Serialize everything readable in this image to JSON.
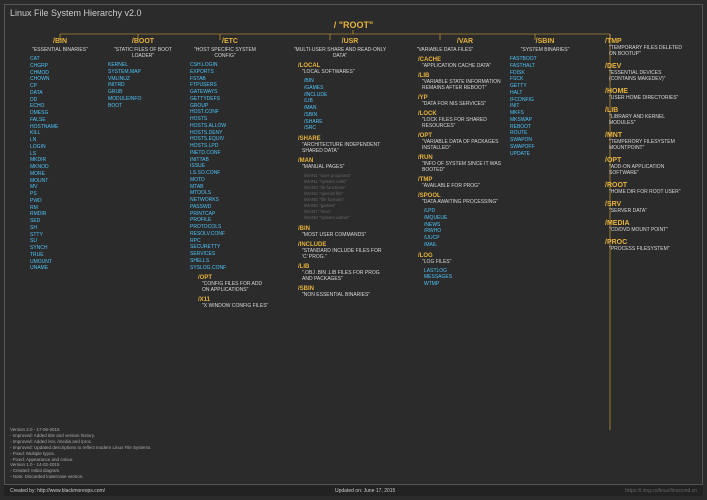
{
  "title": "Linux File System Hierarchy v2.0",
  "root": "/ \"ROOT\"",
  "columns": {
    "bin": {
      "name": "/BIN",
      "desc": "\"ESSENTIAL BINARIES\"",
      "items": [
        "CAT",
        "CHGRP",
        "CHMOD",
        "CHOWN",
        "CP",
        "DATA",
        "DD",
        "ECHO",
        "DMESG",
        "FALSE",
        "HOSTNAME",
        "KILL",
        "LN",
        "LOGIN",
        "LS",
        "MKDIR",
        "MKNOD",
        "MORE",
        "MOUNT",
        "MV",
        "PS",
        "PWD",
        "RM",
        "RMDIR",
        "SED",
        "SH",
        "STTY",
        "SU",
        "SYNCH",
        "TRUE",
        "UMOUNT",
        "UNAME"
      ]
    },
    "boot": {
      "name": "/BOOT",
      "desc": "\"STATIC FILES OF BOOT LOADER\"",
      "items": [
        "KERNEL",
        "SYSTEM.MAP",
        "VMLINUZ",
        "INITRD",
        "GRUB",
        "MODULEINFO",
        "BOOT"
      ]
    },
    "etc": {
      "name": "/ETC",
      "desc": "\"HOST SPECIFIC SYSTEM CONFIG\"",
      "items": [
        "CSH.LOGIN",
        "EXPORTS",
        "FSTAB",
        "FTPUSERS",
        "GATEWAYS",
        "GETTYDEFS",
        "GROUP",
        "HOST.CONF",
        "HOSTS",
        "HOSTS.ALLOW",
        "HOSTS.DENY",
        "HOSTS.EQUIV",
        "HOSTS.LPD",
        "INETD.CONF",
        "INITTAB",
        "ISSUE",
        "LS.SO.CONF",
        "MOTD",
        "MTAB",
        "MTOOLS",
        "NETWORKS",
        "PASSWD",
        "PRINTCAP",
        "PROFILE",
        "PROTOCOLS",
        "RESOLV.CONF",
        "RPC",
        "SECURETTY",
        "SERVICES",
        "SHELLS",
        "SYSLOG.CONF"
      ],
      "subs": [
        {
          "name": "/OPT",
          "desc": "\"CONFIG FILES FOR ADD ON APPLICATIONS\""
        },
        {
          "name": "/X11",
          "desc": "\"X WINDOW CONFIG FILES\""
        }
      ]
    },
    "usr": {
      "name": "/USR",
      "desc": "\"MULTI-USER SHARE AND READ-ONLY DATA\"",
      "subs": [
        {
          "name": "/LOCAL",
          "desc": "\"LOCAL SOFTWARES\"",
          "items": [
            "/BIN",
            "/GAMES",
            "/INCLUDE",
            "/LIB",
            "/MAN",
            "/SBIN",
            "/SHARE",
            "/SRC"
          ]
        },
        {
          "name": "/SHARE",
          "desc": "\"ARCHITECTURE INDEPENDENT SHARED DATA\""
        },
        {
          "name": "/MAN",
          "desc": "\"MANUAL PAGES\"",
          "man": [
            "/MAN1 \"user programs\"",
            "/MAN2 \"system calls\"",
            "/MAN3 \"lib functions\"",
            "/MAN4 \"special file\"",
            "/MAN5 \"file formats\"",
            "/MAN6 \"games\"",
            "/MAN7 \"misc\"",
            "/MAN8 \"system admin\""
          ]
        },
        {
          "name": "/BIN",
          "desc": "\"MOST USER COMMANDS\""
        },
        {
          "name": "/INCLUDE",
          "desc": "\"STANDARD INCLUDE FILES FOR 'C' PROG.\""
        },
        {
          "name": "/LIB",
          "desc": "\".OBJ .BIN .LIB FILES FOR PROG AND PACKAGES\""
        },
        {
          "name": "/SBIN",
          "desc": "\"NON ESSENTIAL BINARIES\""
        }
      ]
    },
    "var": {
      "name": "/VAR",
      "desc": "\"VARIABLE DATA FILES\"",
      "subs": [
        {
          "name": "/CACHE",
          "desc": "\"APPLICATION CACHE DATA\""
        },
        {
          "name": "/LIB",
          "desc": "\"VARIABLE STATE INFORMATION REMAINS AFTER REBOOT\""
        },
        {
          "name": "/YP",
          "desc": "\"DATA FOR NIS SERVICES\""
        },
        {
          "name": "/LOCK",
          "desc": "\"LOCK FILES FOR SHARED RESOURCES\""
        },
        {
          "name": "/OPT",
          "desc": "\"VARIABLE DATA OF PACKAGES INSTALLED\""
        },
        {
          "name": "/RUN",
          "desc": "\"INFO OF SYSTEM SINCE IT WAS BOOTED\""
        },
        {
          "name": "/TMP",
          "desc": "\"AVAILABLE FOR PROG\""
        },
        {
          "name": "/SPOOL",
          "desc": "\"DATA AWAITING PROCESSING\"",
          "items": [
            "/LPD",
            "/MQUEUE",
            "/NEWS",
            "/RWHO",
            "/UUCP",
            "/MAIL"
          ]
        },
        {
          "name": "/LOG",
          "desc": "\"LOG FILES\"",
          "items": [
            "LASTLOG",
            "MESSAGES",
            "WTMP"
          ]
        }
      ]
    },
    "sbin": {
      "name": "/SBIN",
      "desc": "\"SYSTEM BINARIES\"",
      "items": [
        "FASTBOOT",
        "FASTHALT",
        "FDISK",
        "FSCK",
        "GETTY",
        "HALT",
        "IFCONFIG",
        "INIT",
        "MKFS",
        "MKSWAP",
        "REBOOT",
        "ROUTE",
        "SWAPON",
        "SWAPOFF",
        "UPDATE"
      ]
    }
  },
  "right": [
    {
      "name": "/TMP",
      "desc": "\"TEMPORARY FILES DELETED ON BOOTUP\""
    },
    {
      "name": "/DEV",
      "desc": "\"ESSENTIAL DEVICES (CONTAINS MAKEDEV)\""
    },
    {
      "name": "/HOME",
      "desc": "\"USER HOME DIRECTORIES\""
    },
    {
      "name": "/LIB",
      "desc": "\"LIBRARY AND KERNEL MODULES\""
    },
    {
      "name": "/MNT",
      "desc": "\"TEMPERORY FILESYSTEM MOUNTPOINT\""
    },
    {
      "name": "/OPT",
      "desc": "\"ADD-ON APPLICATION SOFTWARE\""
    },
    {
      "name": "/ROOT",
      "desc": "\"HOME DIR FOR ROOT USER\""
    },
    {
      "name": "/SRV",
      "desc": "\"SERVER DATA\""
    },
    {
      "name": "/MEDIA",
      "desc": "\"CD/DVD MOUNT POINT\""
    },
    {
      "name": "/PROC",
      "desc": "\"PROCESS FILESYSTEM\""
    }
  ],
  "version_notes": [
    "Version 2.0 - 17-06-2015",
    "- Improved: Added title and version history.",
    "- Improved: Added /srv, /media and /proc.",
    "- Improved: Updated descriptions to reflect modern Linux File Systems.",
    "- Fixed: Multiple typos.",
    "- Fixed: Appearance and colour.",
    "Version 1.0 - 14-02-2015",
    "- Created: Initial diagram.",
    "- Note: Discarded lowercase version."
  ],
  "footer": {
    "created_by": "Created by: http://www.blackmoreops.com/",
    "updated": "Updated on: June 17, 2015",
    "url": "https://i.img.co/linux/linuxcmd.cn"
  }
}
